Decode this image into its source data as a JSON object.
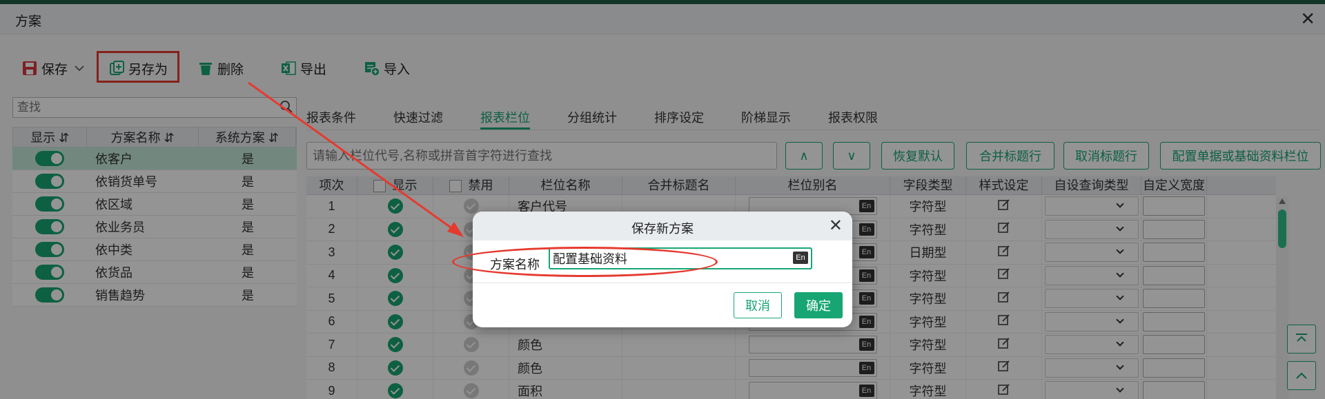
{
  "window": {
    "title": "方案",
    "close_glyph": "✕"
  },
  "toolbar": {
    "save": "保存",
    "save_as": "另存为",
    "delete": "删除",
    "export": "导出",
    "import": "导入"
  },
  "left": {
    "search_placeholder": "查找",
    "headers": {
      "show": "显示",
      "name": "方案名称",
      "system": "系统方案"
    },
    "rows": [
      {
        "name": "依客户",
        "system": "是"
      },
      {
        "name": "依销货单号",
        "system": "是"
      },
      {
        "name": "依区域",
        "system": "是"
      },
      {
        "name": "依业务员",
        "system": "是"
      },
      {
        "name": "依中类",
        "system": "是"
      },
      {
        "name": "依货品",
        "system": "是"
      },
      {
        "name": "销售趋势",
        "system": "是"
      }
    ]
  },
  "tabs": [
    "报表条件",
    "快速过滤",
    "报表栏位",
    "分组统计",
    "排序设定",
    "阶梯显示",
    "报表权限"
  ],
  "right": {
    "search_placeholder": "请输入栏位代号,名称或拼音首字符进行查找",
    "up_glyph": "∧",
    "down_glyph": "∨",
    "restore": "恢复默认",
    "merge_title": "合并标题行",
    "cancel_title": "取消标题行",
    "config_fields": "配置单据或基础资料栏位"
  },
  "grid": {
    "headers": {
      "idx": "项次",
      "show": "显示",
      "disable": "禁用",
      "field_name": "栏位名称",
      "merge_title": "合并标题名",
      "alias": "栏位别名",
      "field_type": "字段类型",
      "style": "样式设定",
      "query_type": "自设查询类型",
      "width": "自定义宽度"
    },
    "rows": [
      {
        "idx": "1",
        "name": "客户代号",
        "type": "字符型"
      },
      {
        "idx": "2",
        "name": "",
        "type": "字符型"
      },
      {
        "idx": "3",
        "name": "",
        "type": "日期型"
      },
      {
        "idx": "4",
        "name": "",
        "type": "字符型"
      },
      {
        "idx": "5",
        "name": "",
        "type": "字符型"
      },
      {
        "idx": "6",
        "name": "",
        "type": "字符型"
      },
      {
        "idx": "7",
        "name": "颜色",
        "type": "字符型"
      },
      {
        "idx": "8",
        "name": "颜色",
        "type": "字符型"
      },
      {
        "idx": "9",
        "name": "面积",
        "type": "字符型"
      }
    ],
    "en_badge": "En"
  },
  "dialog": {
    "title": "保存新方案",
    "label": "方案名称",
    "value": "配置基础资料",
    "cancel": "取消",
    "ok": "确定",
    "close_glyph": "✕"
  },
  "colors": {
    "accent": "#17a673",
    "annotation": "#e53a2f"
  }
}
